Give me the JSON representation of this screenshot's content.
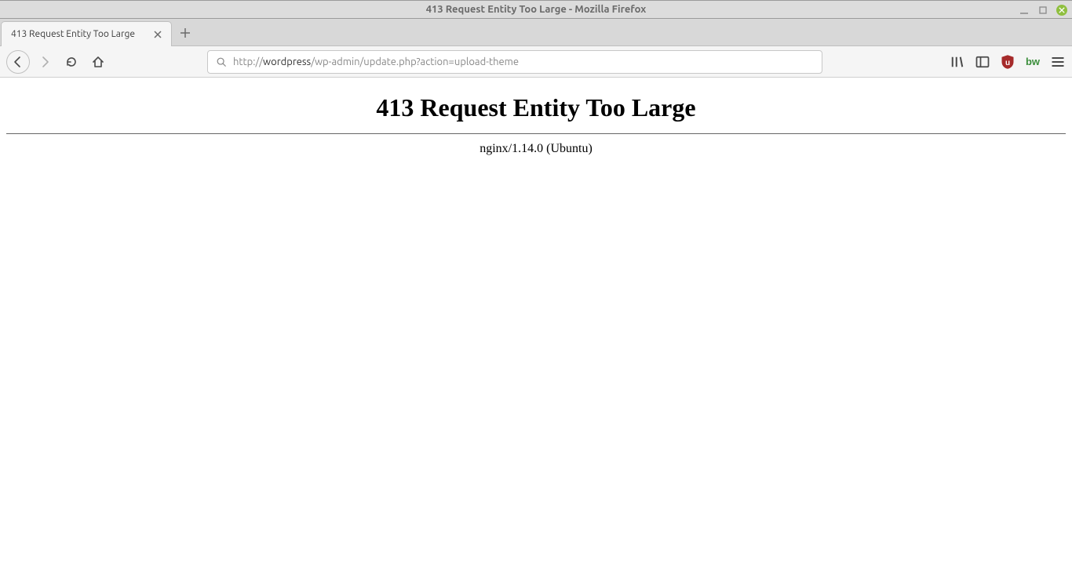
{
  "window": {
    "title": "413 Request Entity Too Large - Mozilla Firefox"
  },
  "tab": {
    "title": "413 Request Entity Too Large"
  },
  "url": {
    "prefix": "http://",
    "host": "wordpress",
    "path": "/wp-admin/update.php?action=upload-theme"
  },
  "page": {
    "heading": "413 Request Entity Too Large",
    "server": "nginx/1.14.0 (Ubuntu)"
  }
}
